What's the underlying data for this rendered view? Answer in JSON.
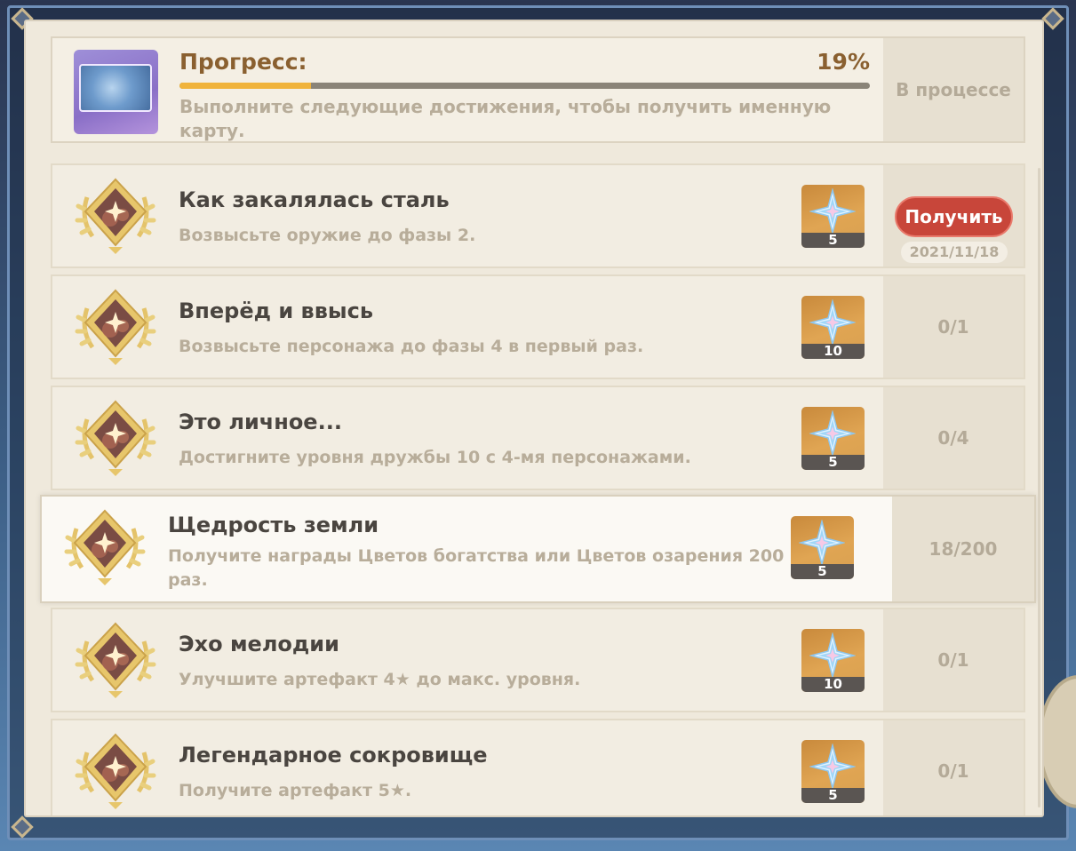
{
  "progress": {
    "title": "Прогресс:",
    "percent_text": "19%",
    "percent": 19,
    "description": "Выполните следующие достижения, чтобы получить именную карту.",
    "status": "В процессе"
  },
  "achievements": [
    {
      "title": "Как закалялась сталь",
      "description": "Возвысьте оружие до фазы 2.",
      "reward_count": "5",
      "claim_label": "Получить",
      "date": "2021/11/18",
      "claimable": true
    },
    {
      "title": "Вперёд и ввысь",
      "description": "Возвысьте персонажа до фазы 4 в первый раз.",
      "reward_count": "10",
      "status": "0/1"
    },
    {
      "title": "Это личное...",
      "description": "Достигните уровня дружбы 10 с 4-мя персонажами.",
      "reward_count": "5",
      "status": "0/4"
    },
    {
      "title": "Щедрость земли",
      "description": "Получите награды Цветов богатства или Цветов озарения 200 раз.",
      "reward_count": "5",
      "status": "18/200"
    },
    {
      "title": "Эхо мелодии",
      "description": "Улучшите артефакт 4★ до макс. уровня.",
      "reward_count": "10",
      "status": "0/1"
    },
    {
      "title": "Легендарное сокровище",
      "description": "Получите артефакт 5★.",
      "reward_count": "5",
      "status": "0/1"
    }
  ],
  "icons": {
    "medal": "laurel-medal-icon",
    "reward": "primogem-icon"
  },
  "colors": {
    "accent": "#f0b33b",
    "claim_button": "#c8463a",
    "panel": "#efe9dc",
    "title_brown": "#8a6030"
  }
}
